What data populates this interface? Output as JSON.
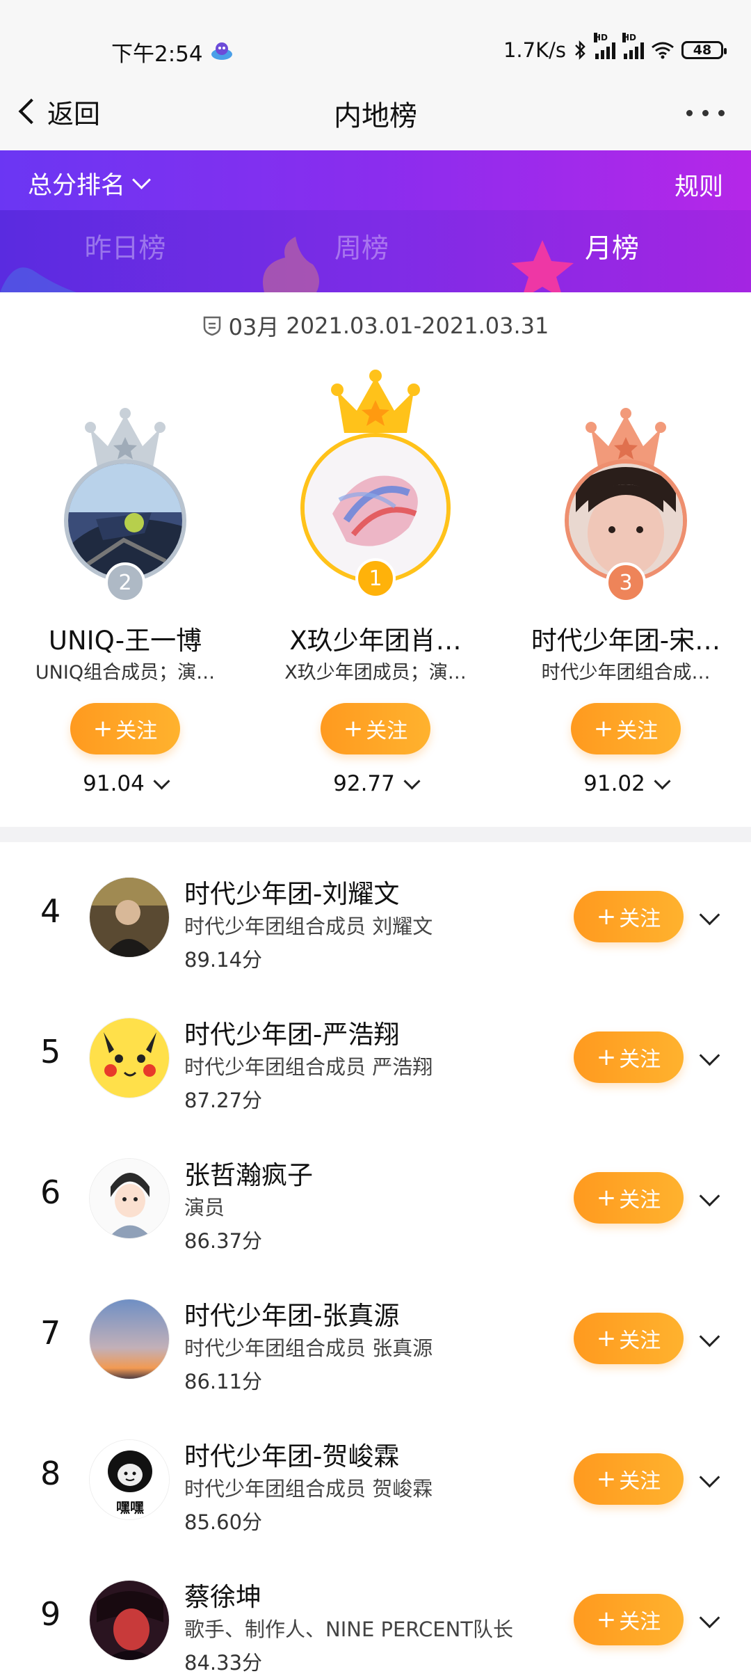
{
  "status_bar": {
    "time": "下午2:54",
    "net_speed": "1.7K/s",
    "battery": "48",
    "hd_label": "HD"
  },
  "nav": {
    "back_label": "返回",
    "title": "内地榜"
  },
  "header": {
    "sort_label": "总分排名",
    "rules_label": "规则",
    "tabs": [
      {
        "label": "昨日榜",
        "active": false
      },
      {
        "label": "周榜",
        "active": false
      },
      {
        "label": "月榜",
        "active": true
      }
    ]
  },
  "date_range": {
    "month": "03月",
    "range": "2021.03.01-2021.03.31"
  },
  "follow_label": "关注",
  "podium": [
    {
      "rank": "2",
      "name": "UNIQ-王一博",
      "desc": "UNIQ组合成员；演…",
      "score": "91.04",
      "tier": "silver"
    },
    {
      "rank": "1",
      "name": "X玖少年团肖…",
      "desc": "X玖少年团成员；演…",
      "score": "92.77",
      "tier": "gold"
    },
    {
      "rank": "3",
      "name": "时代少年团-宋…",
      "desc": "时代少年团组合成…",
      "score": "91.02",
      "tier": "bronze"
    }
  ],
  "list": [
    {
      "rank": "4",
      "name": "时代少年团-刘耀文",
      "desc": "时代少年团组合成员 刘耀文",
      "score": "89.14分"
    },
    {
      "rank": "5",
      "name": "时代少年团-严浩翔",
      "desc": "时代少年团组合成员 严浩翔",
      "score": "87.27分"
    },
    {
      "rank": "6",
      "name": "张哲瀚疯子",
      "desc": "演员",
      "score": "86.37分"
    },
    {
      "rank": "7",
      "name": "时代少年团-张真源",
      "desc": "时代少年团组合成员 张真源",
      "score": "86.11分"
    },
    {
      "rank": "8",
      "name": "时代少年团-贺峻霖",
      "desc": "时代少年团组合成员 贺峻霖",
      "score": "85.60分",
      "avatar_caption": "嘿嘿"
    },
    {
      "rank": "9",
      "name": "蔡徐坤",
      "desc": "歌手、制作人、NINE PERCENT队长",
      "score": "84.33分"
    }
  ],
  "colors": {
    "accent_orange": "#ffa424",
    "header_purple": "#7a30ee",
    "gold": "#ffc21a",
    "silver": "#b8c3cf",
    "bronze": "#ee8f6f"
  }
}
